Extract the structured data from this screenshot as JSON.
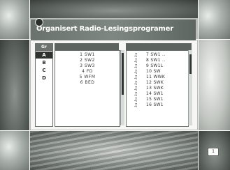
{
  "screen": {
    "title": "Organisert Radio-Lesingsprogramer",
    "page_badge": "1"
  },
  "folders": {
    "header": "Gr",
    "items": [
      {
        "label": "A",
        "selected": true
      },
      {
        "label": "B",
        "selected": false
      },
      {
        "label": "C",
        "selected": false
      },
      {
        "label": "D",
        "selected": false
      }
    ]
  },
  "channel_list": {
    "header": "",
    "rows": [
      "1 SW1",
      "2 SW2",
      "3 SW3",
      "4 FD",
      "5 WFM",
      "6 BED"
    ]
  },
  "program_list": {
    "header": "",
    "icon": "music-note-icon",
    "rows": [
      "7 SW1 ..",
      "8 SW1 ..",
      "9 SW1L",
      "10 SW",
      "11 WWK",
      "12 SWK",
      "13 SWK",
      "14 SW1",
      "15 SW1",
      "16 SW1"
    ]
  }
}
